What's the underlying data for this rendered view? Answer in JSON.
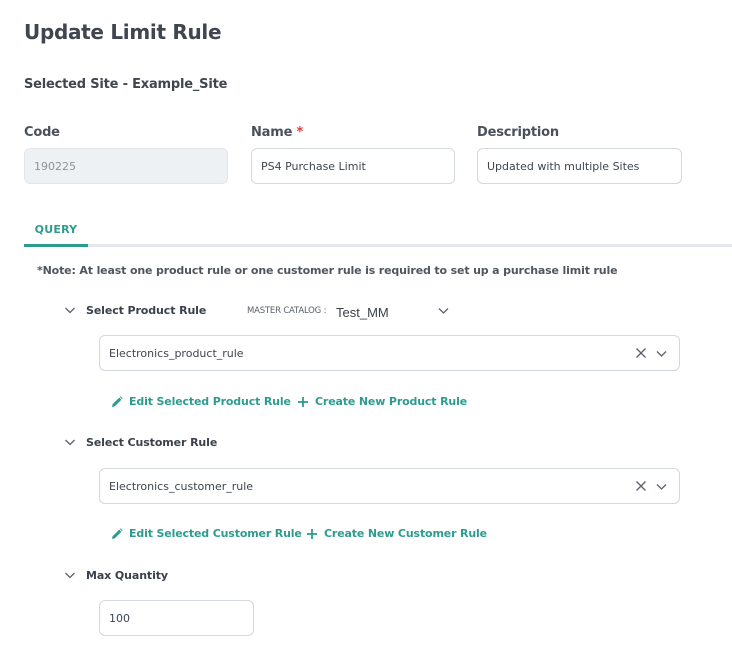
{
  "page": {
    "title": "Update Limit Rule",
    "selected_site": "Selected Site - Example_Site"
  },
  "fields": {
    "code": {
      "label": "Code",
      "value": "190225",
      "disabled": true
    },
    "name": {
      "label": "Name",
      "required_marker": "*",
      "value": "PS4 Purchase Limit"
    },
    "description": {
      "label": "Description",
      "value": "Updated with multiple Sites"
    }
  },
  "tabs": [
    {
      "label": "QUERY",
      "active": true
    }
  ],
  "query": {
    "note": "*Note: At least one product rule or one customer rule is required to set up a purchase limit rule",
    "product_rule": {
      "section_label": "Select Product Rule",
      "master_catalog_label": "MASTER CATALOG :",
      "master_catalog_value": "Test_MM",
      "selected_value": "Electronics_product_rule",
      "edit_link": "Edit Selected Product Rule",
      "create_link": "Create New Product Rule"
    },
    "customer_rule": {
      "section_label": "Select Customer Rule",
      "selected_value": "Electronics_customer_rule",
      "edit_link": "Edit Selected Customer Rule",
      "create_link": "Create New Customer Rule"
    },
    "max_quantity": {
      "section_label": "Max Quantity",
      "value": "100"
    }
  },
  "colors": {
    "accent": "#2d9c8f",
    "required": "#e53935",
    "disabled_bg": "#eef1f4"
  },
  "icons": {
    "section_toggle": "chevron-down-icon",
    "clear": "close-icon",
    "dropdown": "chevron-down-icon",
    "edit": "pencil-icon",
    "create": "plus-icon"
  }
}
